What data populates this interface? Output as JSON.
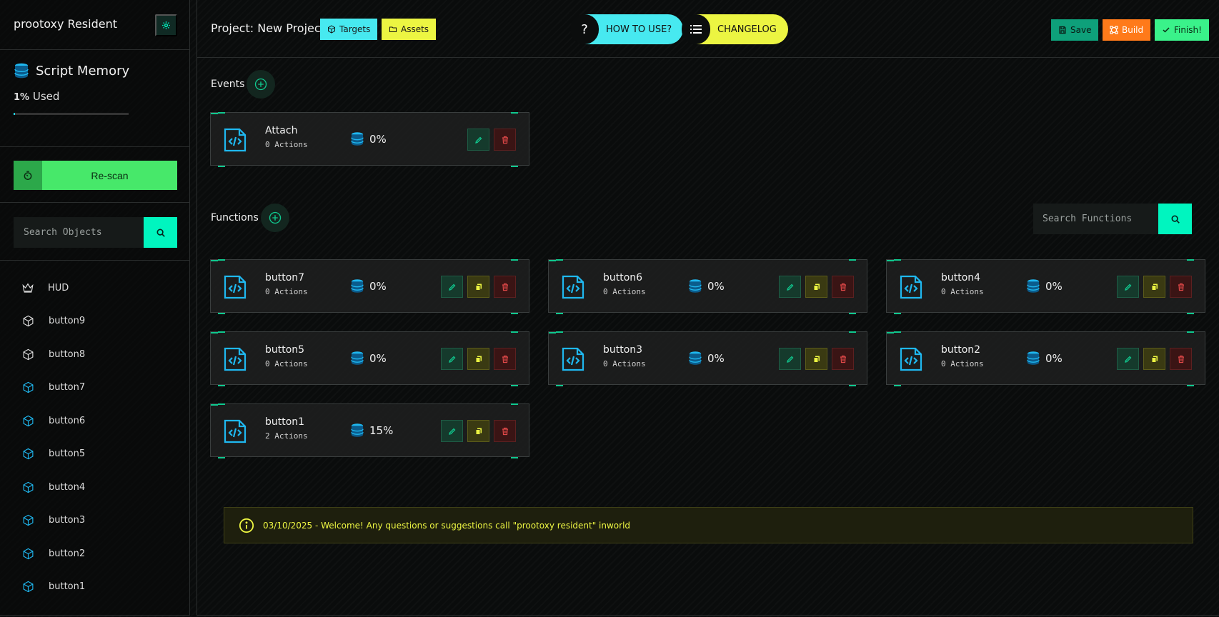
{
  "sidebar": {
    "title": "prootoxy Resident",
    "memory": {
      "title": "Script Memory",
      "used_pct": "1%",
      "used_label": "Used",
      "fraction": 0.01
    },
    "rescan_label": "Re-scan",
    "search_placeholder": "Search Objects",
    "objects": [
      {
        "label": "HUD",
        "icon": "crown-icon"
      },
      {
        "label": "button9",
        "icon": "cube-icon"
      },
      {
        "label": "button8",
        "icon": "cube-icon"
      },
      {
        "label": "button7",
        "icon": "cube-blue-icon"
      },
      {
        "label": "button6",
        "icon": "cube-blue-icon"
      },
      {
        "label": "button5",
        "icon": "cube-blue-icon"
      },
      {
        "label": "button4",
        "icon": "cube-blue-icon"
      },
      {
        "label": "button3",
        "icon": "cube-blue-icon"
      },
      {
        "label": "button2",
        "icon": "cube-blue-icon"
      },
      {
        "label": "button1",
        "icon": "cube-blue-icon"
      }
    ]
  },
  "topbar": {
    "project_title": "Project: New Project",
    "targets_label": "Targets",
    "assets_label": "Assets",
    "howto_label": "HOW TO USE?",
    "howto_icon": "?",
    "changelog_label": "CHANGELOG",
    "save_label": "Save",
    "build_label": "Build",
    "finish_label": "Finish!"
  },
  "events": {
    "label": "Events",
    "items": [
      {
        "name": "Attach",
        "actions": "0 Actions",
        "pct": "0%"
      }
    ]
  },
  "functions": {
    "label": "Functions",
    "search_placeholder": "Search Functions",
    "items": [
      {
        "name": "button7",
        "actions": "0 Actions",
        "pct": "0%"
      },
      {
        "name": "button6",
        "actions": "0 Actions",
        "pct": "0%"
      },
      {
        "name": "button4",
        "actions": "0 Actions",
        "pct": "0%"
      },
      {
        "name": "button5",
        "actions": "0 Actions",
        "pct": "0%"
      },
      {
        "name": "button3",
        "actions": "0 Actions",
        "pct": "0%"
      },
      {
        "name": "button2",
        "actions": "0 Actions",
        "pct": "0%"
      },
      {
        "name": "button1",
        "actions": "2 Actions",
        "pct": "15%"
      }
    ]
  },
  "notice": {
    "text": "03/10/2025 - Welcome! Any questions or suggestions call \"prootoxy resident\" inworld"
  },
  "colors": {
    "accent_teal": "#00f5bf",
    "accent_cyan": "#47e9f0",
    "accent_yellow": "#ecf542",
    "accent_green": "#47e86a",
    "accent_orange": "#ff7a1a",
    "icon_blue": "#1fb8f0"
  }
}
